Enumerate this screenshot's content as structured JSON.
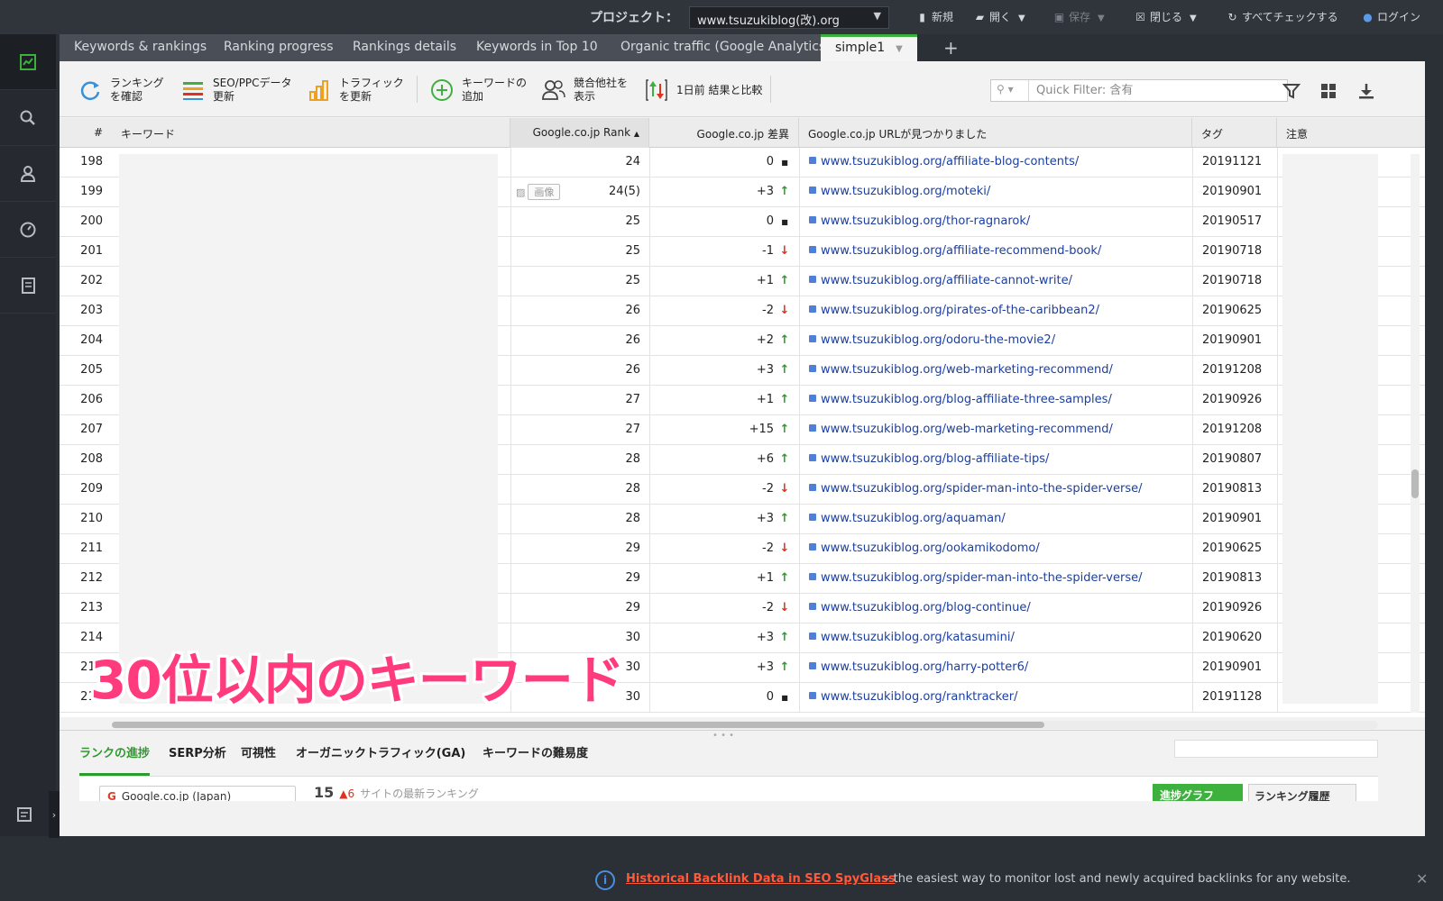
{
  "topbar": {
    "project_label": "プロジェクト：",
    "project_value": "www.tsuzukiblog(改).org",
    "actions": {
      "new": "新規",
      "open": "開く",
      "save": "保存",
      "close": "閉じる",
      "check_all": "すべてチェックする",
      "login": "ログイン"
    }
  },
  "tabs": [
    {
      "label": "Keywords & rankings"
    },
    {
      "label": "Ranking progress"
    },
    {
      "label": "Rankings details"
    },
    {
      "label": "Keywords in Top 10"
    },
    {
      "label": "Organic traffic (Google Analytics)"
    },
    {
      "label": "simple1"
    }
  ],
  "toolbar": {
    "check_rankings": [
      "ランキング",
      "を確認"
    ],
    "update_seo_ppc": [
      "SEO/PPCデータ",
      "更新"
    ],
    "update_traffic": [
      "トラフィック",
      "を更新"
    ],
    "add_keywords": [
      "キーワードの",
      "追加"
    ],
    "show_competitors": [
      "競合他社を",
      "表示"
    ],
    "compare": "1日前 結果と比較",
    "quick_filter_placeholder": "Quick Filter: 含有"
  },
  "table": {
    "headers": {
      "num": "#",
      "keyword": "キーワード",
      "rank": "Google.co.jp Rank",
      "diff": "Google.co.jp 差異",
      "url": "Google.co.jp URLが見つかりました",
      "tag": "タグ",
      "note": "注意"
    },
    "image_label": "画像",
    "rows": [
      {
        "num": "198",
        "rank": "24",
        "diff": "0",
        "trend": "same",
        "url": "www.tsuzukiblog.org/affiliate-blog-contents/",
        "tag": "20191121"
      },
      {
        "num": "199",
        "rank": "24(5)",
        "diff": "+3",
        "trend": "up",
        "url": "www.tsuzukiblog.org/moteki/",
        "tag": "20190901",
        "image": true
      },
      {
        "num": "200",
        "rank": "25",
        "diff": "0",
        "trend": "same",
        "url": "www.tsuzukiblog.org/thor-ragnarok/",
        "tag": "20190517"
      },
      {
        "num": "201",
        "rank": "25",
        "diff": "-1",
        "trend": "down",
        "url": "www.tsuzukiblog.org/affiliate-recommend-book/",
        "tag": "20190718"
      },
      {
        "num": "202",
        "rank": "25",
        "diff": "+1",
        "trend": "up",
        "url": "www.tsuzukiblog.org/affiliate-cannot-write/",
        "tag": "20190718"
      },
      {
        "num": "203",
        "rank": "26",
        "diff": "-2",
        "trend": "down",
        "url": "www.tsuzukiblog.org/pirates-of-the-caribbean2/",
        "tag": "20190625"
      },
      {
        "num": "204",
        "rank": "26",
        "diff": "+2",
        "trend": "up",
        "url": "www.tsuzukiblog.org/odoru-the-movie2/",
        "tag": "20190901"
      },
      {
        "num": "205",
        "rank": "26",
        "diff": "+3",
        "trend": "up",
        "url": "www.tsuzukiblog.org/web-marketing-recommend/",
        "tag": "20191208"
      },
      {
        "num": "206",
        "rank": "27",
        "diff": "+1",
        "trend": "up",
        "url": "www.tsuzukiblog.org/blog-affiliate-three-samples/",
        "tag": "20190926"
      },
      {
        "num": "207",
        "rank": "27",
        "diff": "+15",
        "trend": "up",
        "url": "www.tsuzukiblog.org/web-marketing-recommend/",
        "tag": "20191208"
      },
      {
        "num": "208",
        "rank": "28",
        "diff": "+6",
        "trend": "up",
        "url": "www.tsuzukiblog.org/blog-affiliate-tips/",
        "tag": "20190807"
      },
      {
        "num": "209",
        "rank": "28",
        "diff": "-2",
        "trend": "down",
        "url": "www.tsuzukiblog.org/spider-man-into-the-spider-verse/",
        "tag": "20190813"
      },
      {
        "num": "210",
        "rank": "28",
        "diff": "+3",
        "trend": "up",
        "url": "www.tsuzukiblog.org/aquaman/",
        "tag": "20190901"
      },
      {
        "num": "211",
        "rank": "29",
        "diff": "-2",
        "trend": "down",
        "url": "www.tsuzukiblog.org/ookamikodomo/",
        "tag": "20190625"
      },
      {
        "num": "212",
        "rank": "29",
        "diff": "+1",
        "trend": "up",
        "url": "www.tsuzukiblog.org/spider-man-into-the-spider-verse/",
        "tag": "20190813"
      },
      {
        "num": "213",
        "rank": "29",
        "diff": "-2",
        "trend": "down",
        "url": "www.tsuzukiblog.org/blog-continue/",
        "tag": "20190926"
      },
      {
        "num": "214",
        "rank": "30",
        "diff": "+3",
        "trend": "up",
        "url": "www.tsuzukiblog.org/katasumini/",
        "tag": "20190620"
      },
      {
        "num": "215",
        "rank": "30",
        "diff": "+3",
        "trend": "up",
        "url": "www.tsuzukiblog.org/harry-potter6/",
        "tag": "20190901"
      },
      {
        "num": "216",
        "rank": "30",
        "diff": "0",
        "trend": "same",
        "url": "www.tsuzukiblog.org/ranktracker/",
        "tag": "20191128"
      }
    ]
  },
  "overlay_caption": "30位以内のキーワード",
  "bottom_panel": {
    "tabs": [
      "ランクの進捗",
      "SERP分析",
      "可視性",
      "オーガニックトラフィック(GA)",
      "キーワードの難易度"
    ],
    "engine_chip": "Google.co.jp (Japan)",
    "latest_count": "15",
    "latest_change": "▲6",
    "latest_label": "サイトの最新ランキング",
    "progress_graph_button": "進捗グラフ",
    "ranking_history_button": "ランキング履歴"
  },
  "banner": {
    "link_text": "Historical Backlink Data in SEO SpyGlass",
    "text": "– the easiest way to monitor lost and newly acquired backlinks for any website."
  },
  "colors": {
    "accent_green": "#3db03d",
    "trend_up": "#2e9a2e",
    "trend_down": "#e0311f",
    "link_blue": "#1b3fa0",
    "overlay_pink": "#ff3b7e"
  }
}
